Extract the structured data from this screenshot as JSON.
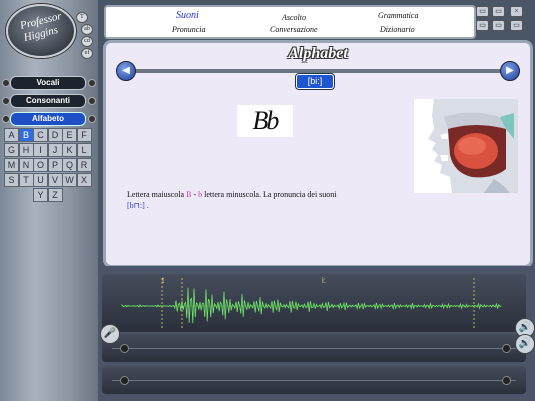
{
  "app": {
    "logo_line1": "Professor",
    "logo_line2": "Higgins",
    "mini_buttons": [
      "T",
      "ab",
      "cd",
      "ef"
    ]
  },
  "sidebar": {
    "buttons": [
      {
        "label": "Vocali",
        "active": false
      },
      {
        "label": "Consonanti",
        "active": false
      },
      {
        "label": "Alfabeto",
        "active": true
      }
    ],
    "letters": [
      "A",
      "B",
      "C",
      "D",
      "E",
      "F",
      "G",
      "H",
      "I",
      "J",
      "K",
      "L",
      "M",
      "N",
      "O",
      "P",
      "Q",
      "R",
      "S",
      "T",
      "U",
      "V",
      "W",
      "X",
      "Y",
      "Z"
    ],
    "selected_letter": "B"
  },
  "topnav": {
    "items": [
      {
        "label": "Suoni",
        "active": true
      },
      {
        "label": "Pronuncia",
        "active": false
      },
      {
        "label": "Ascolto",
        "active": false
      },
      {
        "label": "Conversazione",
        "active": false
      },
      {
        "label": "Grammatica",
        "active": false
      },
      {
        "label": "Dizionario",
        "active": false
      }
    ]
  },
  "main": {
    "title": "Alphabet",
    "phonetic": "[bi:]",
    "glyph": "Bb",
    "prev_icon": "◀",
    "next_icon": "▶",
    "desc_1": "Lettera maiuscola",
    "upper": "B",
    "dash": "-",
    "lower": "b",
    "desc_2": "lettera minuscola. La pronuncia dei suoni",
    "desc_3": "[b⊓:] ."
  },
  "wave": {
    "marker_start": "t",
    "marker_mid": "i:",
    "colors": {
      "waveform": "#6fe36a",
      "markers": "#e4d25a"
    }
  },
  "icons": {
    "mic": "🎤",
    "speaker": "🔊"
  }
}
